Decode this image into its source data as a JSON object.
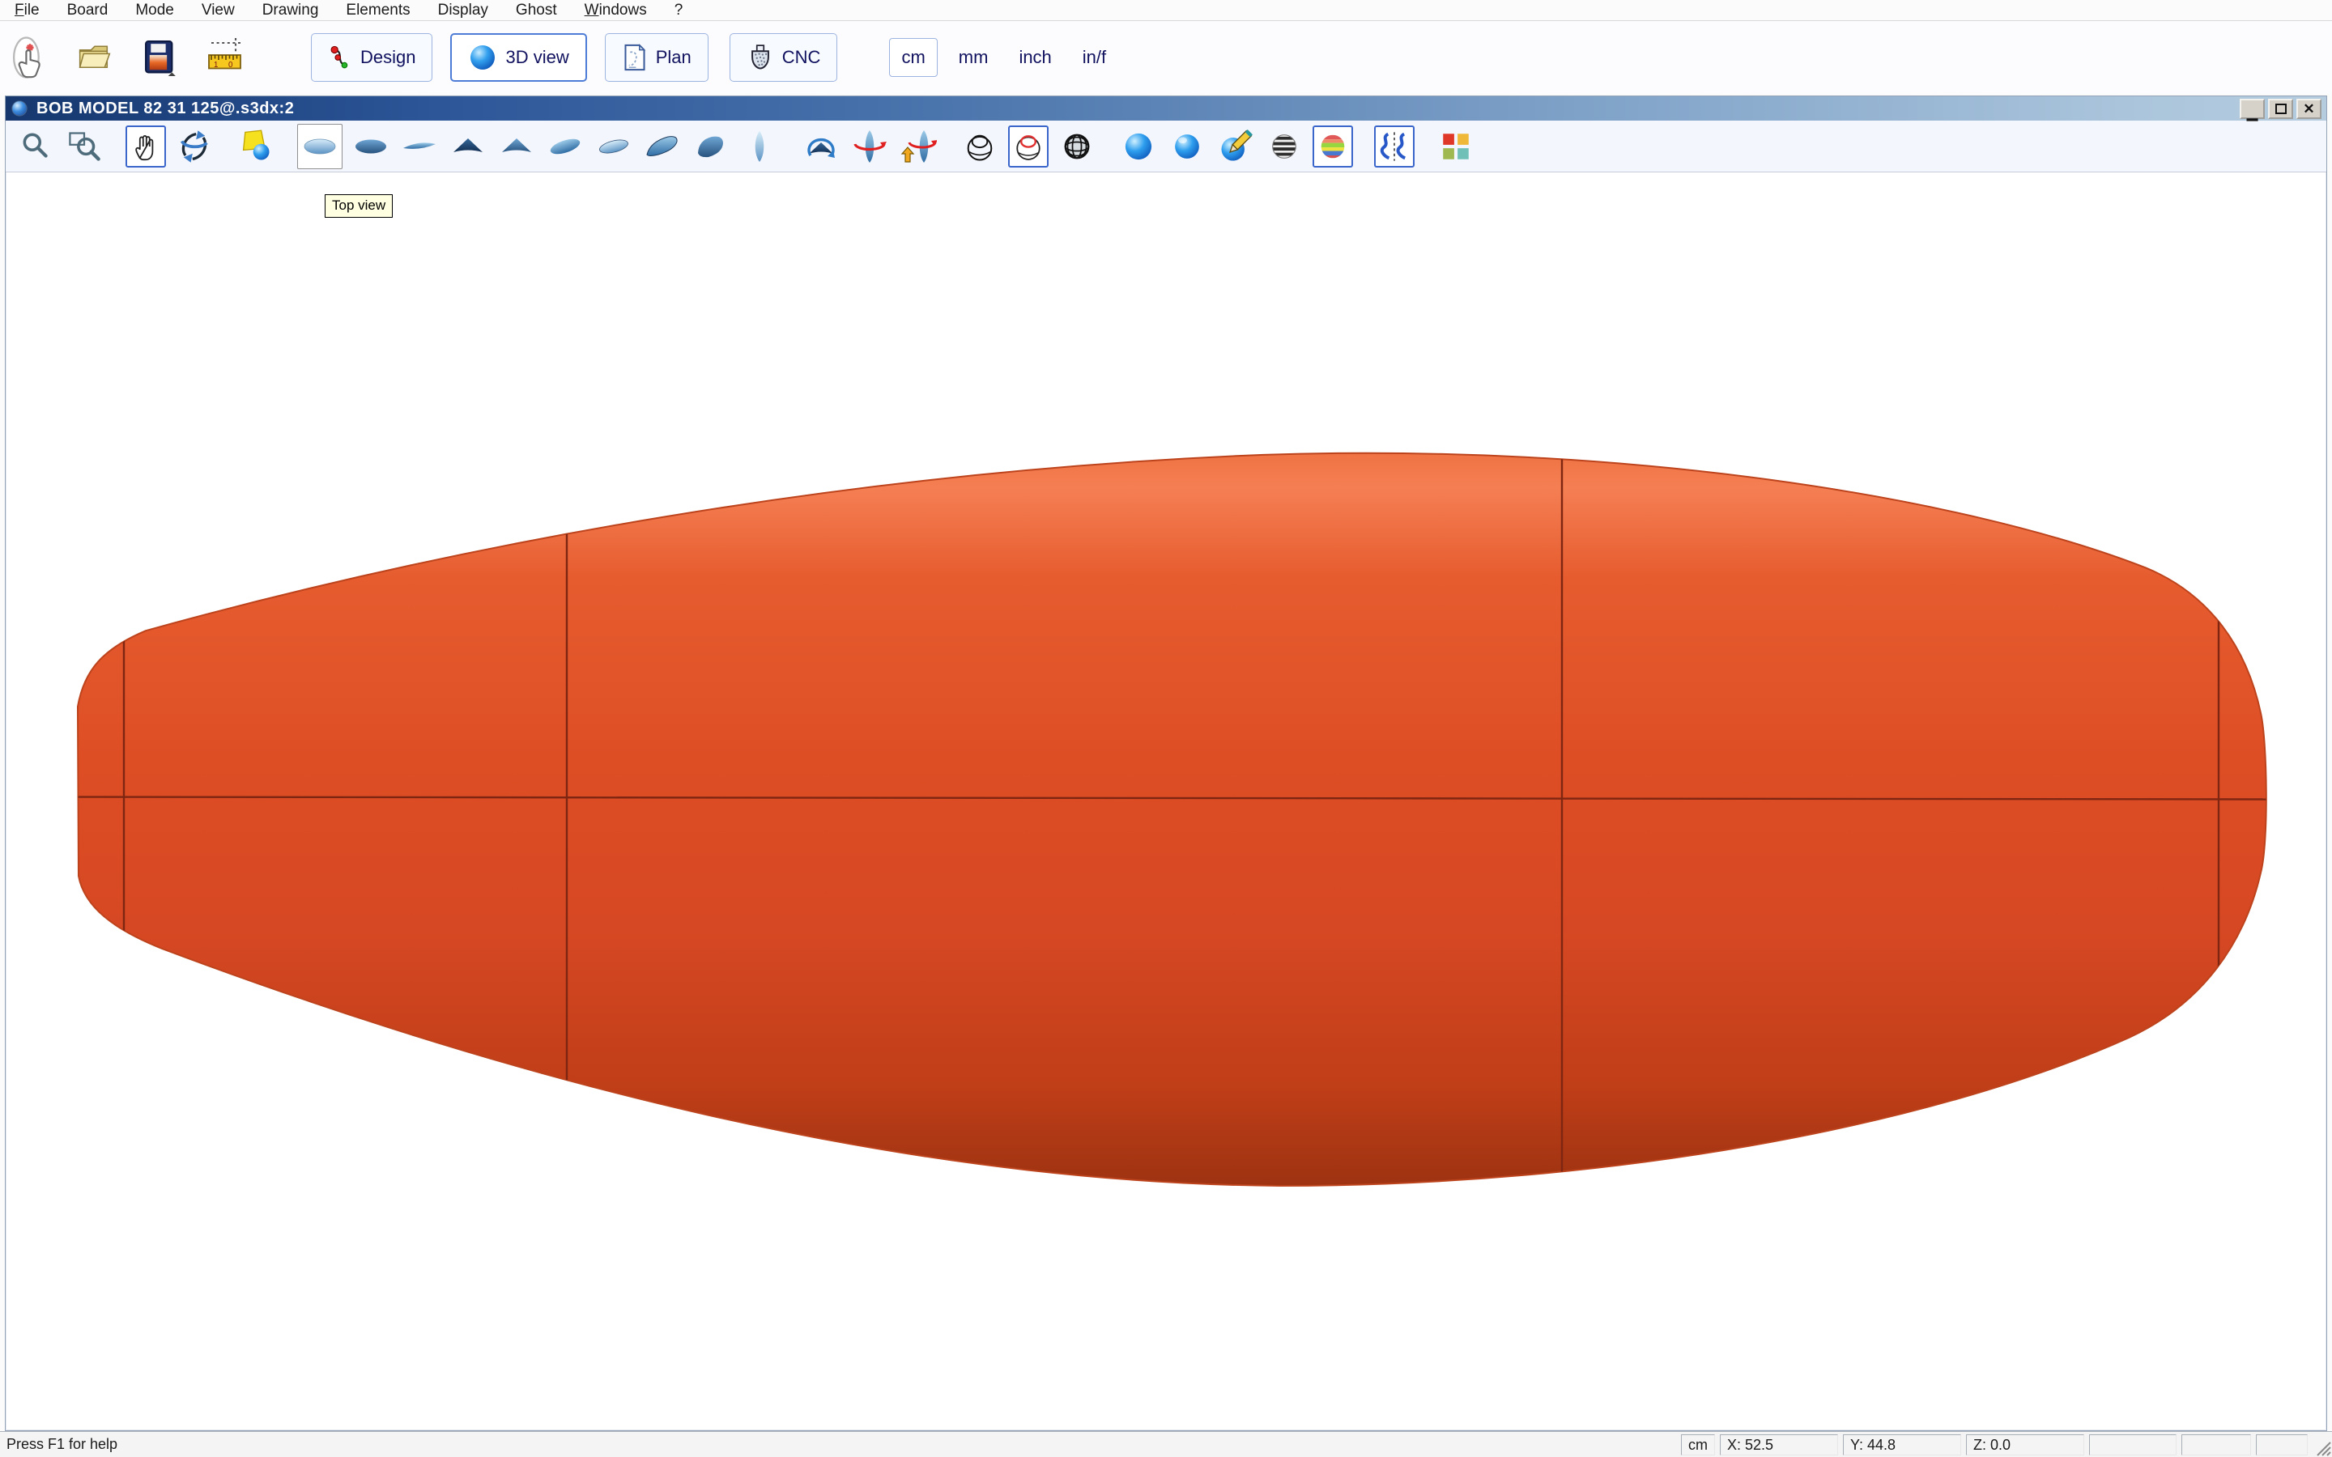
{
  "menu": {
    "items": [
      {
        "label": "File"
      },
      {
        "label": "Board"
      },
      {
        "label": "Mode"
      },
      {
        "label": "View"
      },
      {
        "label": "Drawing"
      },
      {
        "label": "Elements"
      },
      {
        "label": "Display"
      },
      {
        "label": "Ghost"
      },
      {
        "label": "Windows"
      },
      {
        "label": "?"
      }
    ]
  },
  "toolbar": {
    "buttons": [
      {
        "name": "design",
        "label": "Design",
        "active": false
      },
      {
        "name": "3d-view",
        "label": "3D view",
        "active": true
      },
      {
        "name": "plan",
        "label": "Plan",
        "active": false
      },
      {
        "name": "cnc",
        "label": "CNC",
        "active": false
      }
    ],
    "units": [
      {
        "label": "cm",
        "selected": true
      },
      {
        "label": "mm",
        "selected": false
      },
      {
        "label": "inch",
        "selected": false
      },
      {
        "label": "in/f",
        "selected": false
      }
    ],
    "file_icons": [
      "new-board-icon",
      "open-folder-icon",
      "save-icon",
      "ruler-guides-icon"
    ]
  },
  "document_window": {
    "title": "BOB MODEL 82 31 125@.s3dx:2",
    "window_controls": [
      "minimize",
      "maximize",
      "close"
    ]
  },
  "view_toolbar": {
    "icons": [
      "zoom-icon",
      "zoom-area-icon",
      "pan-hand-icon",
      "rotate-3d-icon",
      "light-icon",
      "top-view-icon",
      "bottom-view-icon",
      "side-view-icon",
      "front-view-icon",
      "back-view-icon",
      "perspective-top-icon",
      "perspective-bottom-icon",
      "perspective-tilt-icon",
      "perspective-blob-icon",
      "outline-view-icon",
      "rotate-front-icon",
      "rotate-board-icon",
      "flip-board-icon",
      "wireframe-icon",
      "wireframe-highlight-icon",
      "mesh-sphere-icon",
      "shaded-sphere-icon",
      "smooth-sphere-icon",
      "edit-surface-icon",
      "zebra-stripes-icon",
      "curvature-map-icon",
      "flow-lines-icon",
      "quad-view-icon"
    ],
    "selected": [
      "pan-hand-icon",
      "wireframe-highlight-icon",
      "curvature-map-icon",
      "flow-lines-icon"
    ],
    "hovered": "top-view-icon"
  },
  "tooltip": {
    "text": "Top view"
  },
  "board": {
    "gradient": [
      "#ED6F3E",
      "#F57F53",
      "#E65C2F",
      "#DE4E25",
      "#D64823",
      "#C03E18",
      "#9C3211"
    ],
    "line_color": "#7E2611",
    "outline_color": "#BC431C"
  },
  "statusbar": {
    "help": "Press F1 for help",
    "unit": "cm",
    "x": "X: 52.5",
    "y": "Y: 44.8",
    "z": "Z: 0.0"
  }
}
